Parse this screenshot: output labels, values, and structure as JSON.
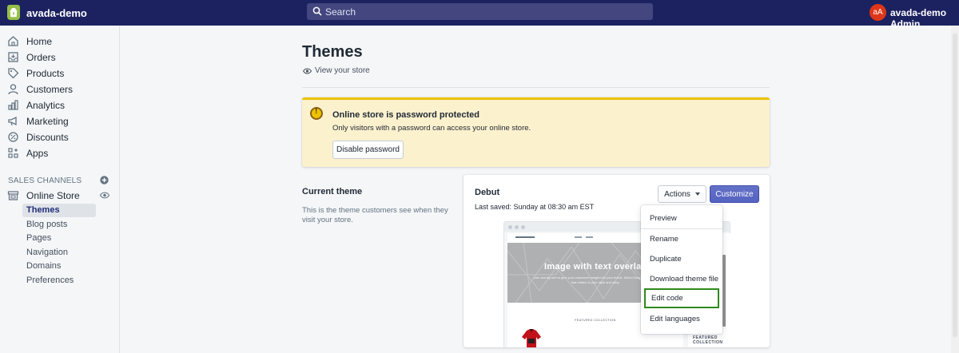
{
  "header": {
    "store_name": "avada-demo",
    "search_placeholder": "Search",
    "user_initials": "aA",
    "user_name": "avada-demo Admin"
  },
  "sidebar": {
    "items": [
      {
        "label": "Home",
        "icon": "home-icon"
      },
      {
        "label": "Orders",
        "icon": "orders-icon"
      },
      {
        "label": "Products",
        "icon": "tag-icon"
      },
      {
        "label": "Customers",
        "icon": "person-icon"
      },
      {
        "label": "Analytics",
        "icon": "bar-chart-icon"
      },
      {
        "label": "Marketing",
        "icon": "megaphone-icon"
      },
      {
        "label": "Discounts",
        "icon": "discount-icon"
      },
      {
        "label": "Apps",
        "icon": "apps-icon"
      }
    ],
    "sales_channels_title": "SALES CHANNELS",
    "online_store": "Online Store",
    "sub_items": [
      "Themes",
      "Blog posts",
      "Pages",
      "Navigation",
      "Domains",
      "Preferences"
    ]
  },
  "page": {
    "title": "Themes",
    "view_store": "View your store"
  },
  "banner": {
    "title": "Online store is password protected",
    "text": "Only visitors with a password can access your online store.",
    "button": "Disable password"
  },
  "current_theme": {
    "heading": "Current theme",
    "description": "This is the theme customers see when they visit your store.",
    "theme_name": "Debut",
    "last_saved": "Last saved: Sunday at 08:30 am EST",
    "actions_label": "Actions",
    "customize_label": "Customize"
  },
  "preview": {
    "hero_title": "Image with text overlay",
    "hero_sub": "Use overlay text to give your customers insight into your brand. Select imagery and text that relates to your style and story.",
    "featured": "FEATURED COLLECTION",
    "side_featured": "FEATURED COLLECTION"
  },
  "menu": {
    "items": [
      "Preview",
      "Rename",
      "Duplicate",
      "Download theme file",
      "Edit code",
      "Edit languages"
    ]
  },
  "colors": {
    "topbar": "#1c2260",
    "accent": "#5c6ac4",
    "highlight_border": "#2e8a1e",
    "warning": "#eec200"
  }
}
